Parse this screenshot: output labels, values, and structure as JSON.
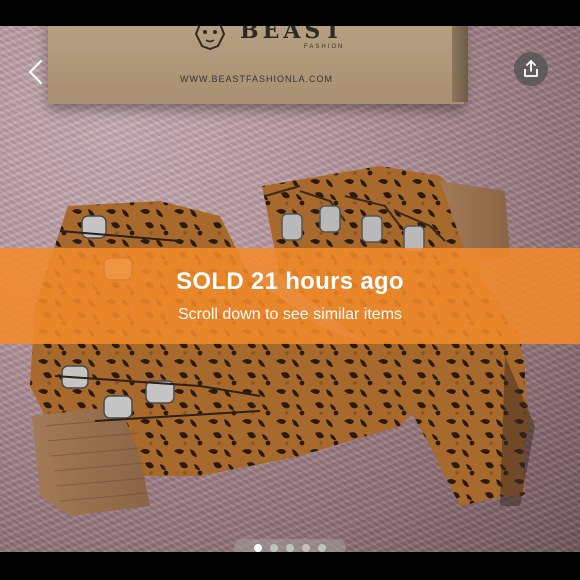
{
  "listing": {
    "brand": {
      "name": "BEAST",
      "sub": "FASHION",
      "url": "WWW.BEASTFASHIONLA.COM"
    },
    "status": {
      "title": "SOLD 21 hours ago",
      "subtitle": "Scroll down to see similar items"
    },
    "gallery": {
      "image_count": 5,
      "active_index": 0
    }
  },
  "colors": {
    "banner": "#F48A2A",
    "fur": "#B8979F",
    "box": "#A88F71"
  }
}
